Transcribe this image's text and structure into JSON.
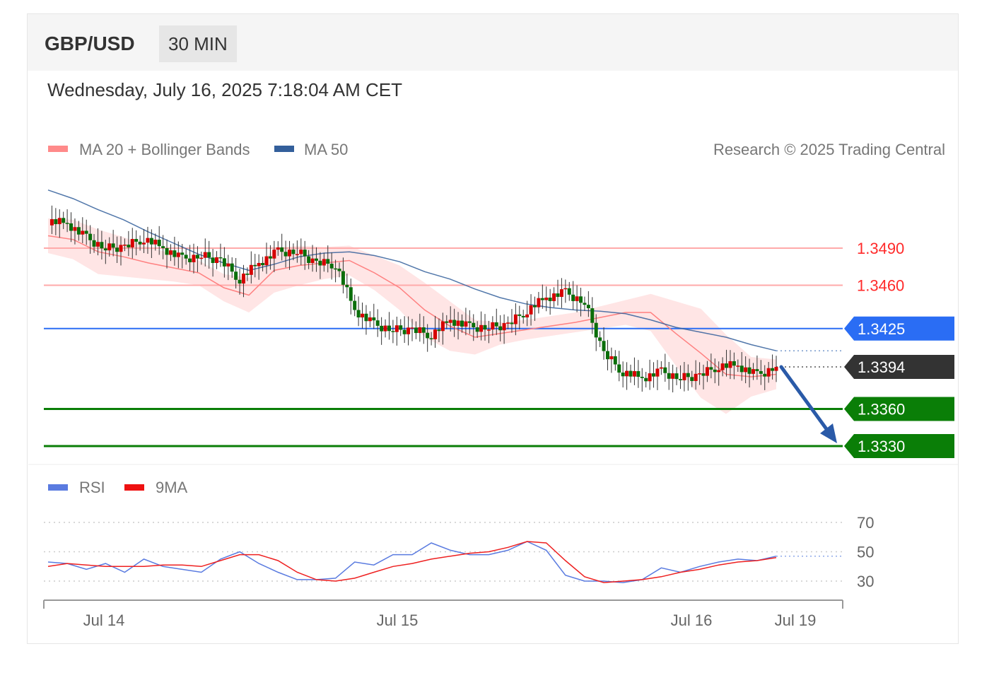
{
  "header": {
    "symbol": "GBP/USD",
    "timeframe": "30 MIN",
    "datetime": "Wednesday, July 16, 2025 7:18:04 AM CET"
  },
  "legend": {
    "ma20": "MA 20 + Bollinger Bands",
    "ma50": "MA 50",
    "credit": "Research © 2025 Trading Central"
  },
  "rsi_legend": {
    "rsi": "RSI",
    "ma9": "9MA"
  },
  "colors": {
    "resistance": "#ff2a2a",
    "pivot": "#2a6df4",
    "current": "#333333",
    "support": "#0a7e07",
    "ma20": "#ff8080",
    "ma50": "#335f9b",
    "band_fill": "#ffe0e0",
    "candle_up": "#d60000",
    "candle_down": "#0a6e0a",
    "arrow": "#2a5aa8",
    "rsi_line": "#5a7be0",
    "rsi_ma": "#ee2020"
  },
  "chart_data": [
    {
      "type": "candlestick",
      "x_labels": [
        "Jul 14",
        "Jul 15",
        "Jul 16",
        "Jul 19"
      ],
      "ylim": [
        1.3325,
        1.3525
      ],
      "levels": [
        {
          "value": 1.349,
          "label": "1.3490",
          "kind": "resistance"
        },
        {
          "value": 1.346,
          "label": "1.3460",
          "kind": "resistance"
        },
        {
          "value": 1.3425,
          "label": "1.3425",
          "kind": "pivot"
        },
        {
          "value": 1.3394,
          "label": "1.3394",
          "kind": "current"
        },
        {
          "value": 1.336,
          "label": "1.3360",
          "kind": "support"
        },
        {
          "value": 1.333,
          "label": "1.3330",
          "kind": "support"
        }
      ],
      "series": [
        {
          "name": "MA 20 + Bollinger Bands",
          "values": [
            1.35,
            1.3497,
            1.3487,
            1.3483,
            1.3478,
            1.3474,
            1.347,
            1.3458,
            1.3452,
            1.3472,
            1.3476,
            1.3478,
            1.348,
            1.347,
            1.3458,
            1.344,
            1.3427,
            1.3418,
            1.3421,
            1.3424,
            1.3427,
            1.343,
            1.3434,
            1.3438,
            1.3438,
            1.3421,
            1.3405,
            1.3388,
            1.3386,
            1.3388
          ]
        },
        {
          "name": "MA 50",
          "values": [
            1.3537,
            1.353,
            1.3521,
            1.3513,
            1.3503,
            1.3494,
            1.3485,
            1.3478,
            1.3472,
            1.3477,
            1.3483,
            1.3486,
            1.3487,
            1.3484,
            1.3479,
            1.3471,
            1.3465,
            1.3457,
            1.345,
            1.3445,
            1.3442,
            1.344,
            1.3439,
            1.3437,
            1.3432,
            1.3426,
            1.3422,
            1.3418,
            1.3412,
            1.3407
          ]
        }
      ],
      "candles_close": [
        1.3512,
        1.351,
        1.3498,
        1.349,
        1.3491,
        1.3498,
        1.349,
        1.3481,
        1.3484,
        1.348,
        1.3465,
        1.3478,
        1.3487,
        1.3487,
        1.3478,
        1.3477,
        1.344,
        1.3428,
        1.3424,
        1.3424,
        1.342,
        1.3432,
        1.3426,
        1.3426,
        1.3428,
        1.344,
        1.345,
        1.3454,
        1.3446,
        1.3405,
        1.339,
        1.3385,
        1.339,
        1.3385,
        1.3387,
        1.3395,
        1.3395,
        1.3387,
        1.3394
      ],
      "forecast": {
        "from": 1.3394,
        "to": 1.333
      }
    },
    {
      "type": "line",
      "ylim": [
        20,
        80
      ],
      "y_ticks": [
        30,
        50,
        70
      ],
      "series": [
        {
          "name": "RSI",
          "values": [
            43,
            42,
            38,
            42,
            36,
            45,
            40,
            38,
            36,
            45,
            50,
            42,
            36,
            31,
            31,
            32,
            43,
            41,
            48,
            48,
            56,
            51,
            48,
            48,
            51,
            57,
            51,
            34,
            30,
            30,
            29,
            31,
            39,
            36,
            40,
            43,
            45,
            44,
            47
          ]
        },
        {
          "name": "9MA",
          "values": [
            40,
            42,
            41,
            40,
            40,
            40,
            41,
            41,
            40,
            44,
            48,
            48,
            44,
            36,
            31,
            30,
            32,
            36,
            40,
            42,
            45,
            47,
            49,
            50,
            53,
            57,
            56,
            44,
            33,
            29,
            30,
            31,
            33,
            36,
            38,
            41,
            43,
            44,
            46
          ]
        }
      ]
    }
  ]
}
